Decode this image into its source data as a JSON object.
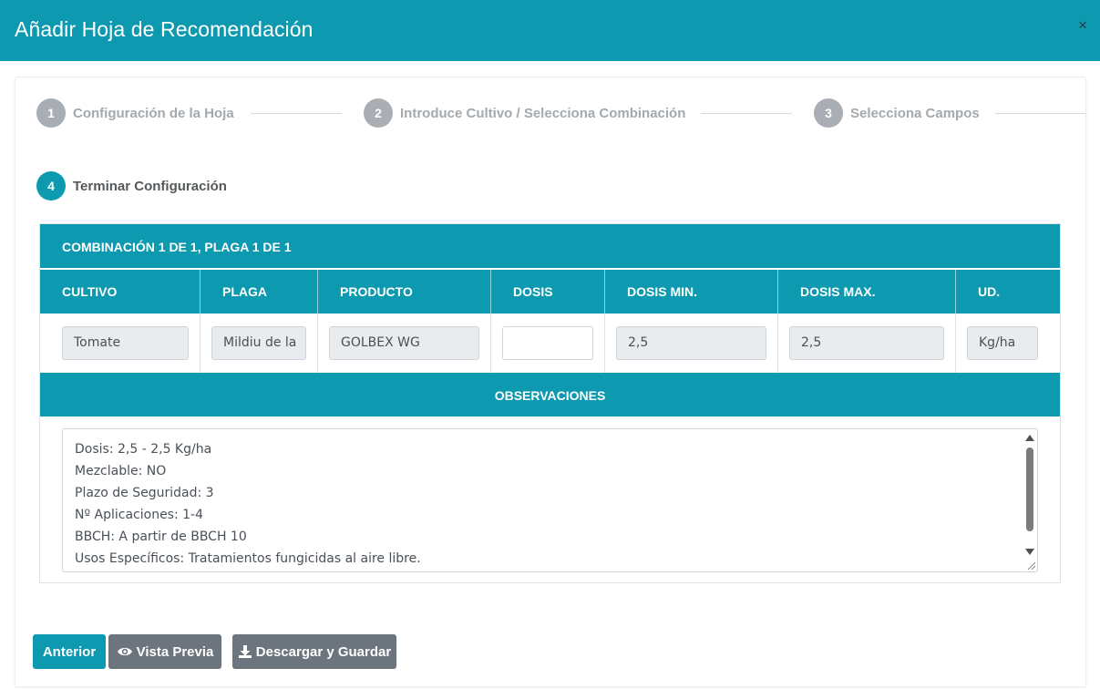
{
  "modal": {
    "title": "Añadir Hoja de Recomendación",
    "close": "×"
  },
  "steps": [
    {
      "num": "1",
      "label": "Configuración de la Hoja"
    },
    {
      "num": "2",
      "label": "Introduce Cultivo / Selecciona Combinación"
    },
    {
      "num": "3",
      "label": "Selecciona Campos"
    },
    {
      "num": "4",
      "label": "Terminar Configuración",
      "active": true
    }
  ],
  "combination": "COMBINACIÓN 1 DE 1, PLAGA 1 DE 1",
  "columns": [
    "CULTIVO",
    "PLAGA",
    "PRODUCTO",
    "DOSIS",
    "DOSIS MIN.",
    "DOSIS MAX.",
    "UD."
  ],
  "row": {
    "cultivo": "Tomate",
    "plaga": "Mildiu de la",
    "producto": "GOLBEX WG",
    "dosis": "",
    "dosis_min": "2,5",
    "dosis_max": "2,5",
    "ud": "Kg/ha"
  },
  "observaciones_label": "OBSERVACIONES",
  "observaciones_lines": [
    "Dosis: 2,5 - 2,5 Kg/ha",
    "Mezclable: NO",
    "Plazo de Seguridad: 3",
    "Nº Aplicaciones: 1-4",
    "BBCH: A partir de BBCH 10",
    "Usos Específicos: Tratamientos fungicidas al aire libre."
  ],
  "buttons": {
    "previous": "Anterior",
    "preview": "Vista Previa",
    "download": "Descargar y Guardar"
  },
  "colors": {
    "accent": "#0d99af",
    "secondary": "#6c757d",
    "step_inactive": "#a8aeb3"
  },
  "icons": {
    "close": "close-icon",
    "preview": "eye-icon",
    "download": "download-icon"
  }
}
